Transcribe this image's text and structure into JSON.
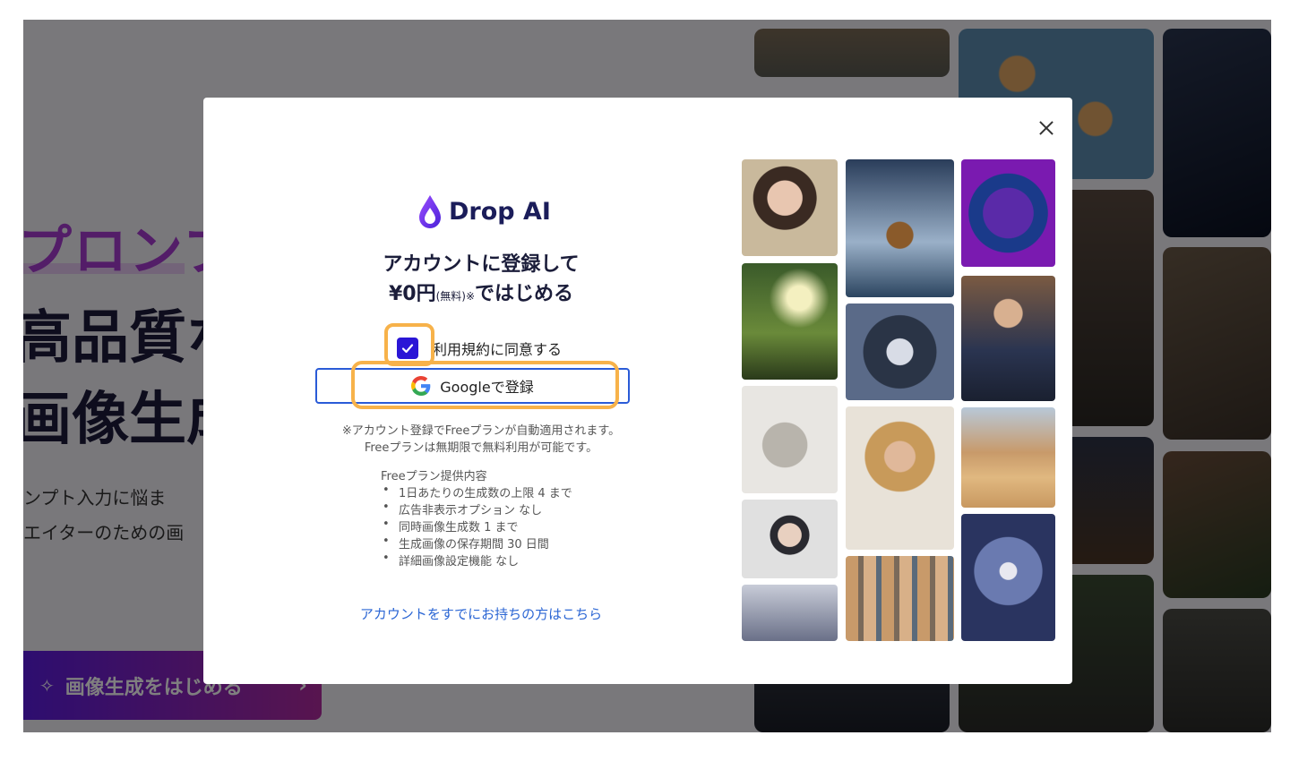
{
  "background": {
    "hero_line1": "プロンプ",
    "hero_line2": "高品質な",
    "hero_line3": "画像生成",
    "sub1": "ンプト入力に悩ま",
    "sub2": "エイターのための画",
    "cta_label": "画像生成をはじめる",
    "cta_icon": "sparkle-icon",
    "cta_arrow": "›"
  },
  "modal": {
    "close_icon": "close-icon",
    "logo_text": "Drop AI",
    "headline_line1": "アカウントに登録して",
    "headline_line2_a": "¥0円",
    "headline_line2_b": "(無料)",
    "headline_line2_c": "※",
    "headline_line2_d": "ではじめる",
    "agree_checked": true,
    "agree_label": "利用規約に同意する",
    "google_label": "Googleで登録",
    "note1": "※アカウント登録でFreeプランが自動適用されます。",
    "note2": "Freeプランは無期限で無料利用が可能です。",
    "plan_title": "Freeプラン提供内容",
    "plan_items": [
      "1日あたりの生成数の上限 4 まで",
      "広告非表示オプション なし",
      "同時画像生成数 1 まで",
      "生成画像の保存期間 30 日間",
      "詳細画像設定機能 なし"
    ],
    "login_link": "アカウントをすでにお持ちの方はこちら"
  },
  "colors": {
    "accent": "#2a16d6",
    "link": "#2b66d4",
    "highlight": "#f7b24a"
  }
}
